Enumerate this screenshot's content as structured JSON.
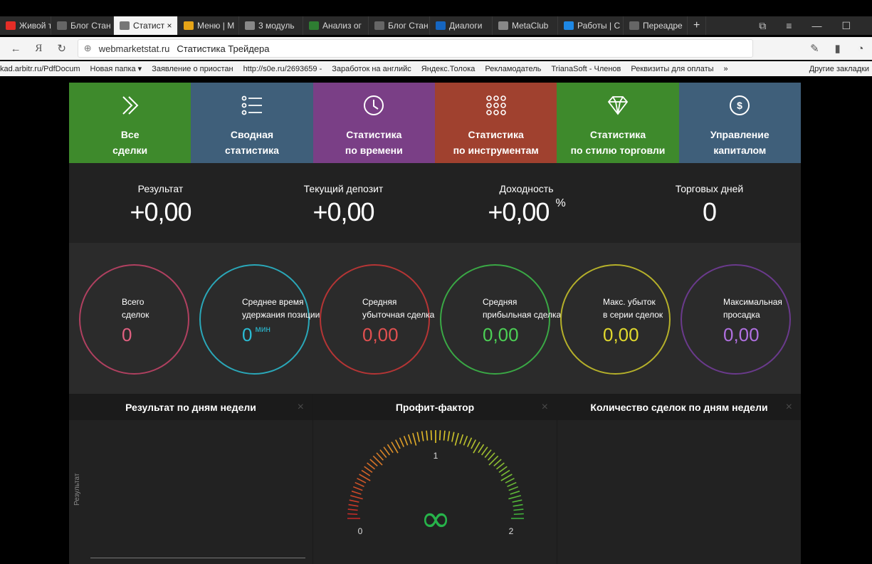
{
  "browser": {
    "tabs": [
      {
        "label": "Живой тр",
        "icon": "youtube-icon",
        "color": "#e52d27"
      },
      {
        "label": "Блог Стан",
        "icon": "page-icon",
        "color": "#666"
      },
      {
        "label": "Статист ×",
        "icon": "site-icon",
        "color": "#777",
        "active": true
      },
      {
        "label": "Меню | М",
        "icon": "st-icon",
        "color": "#e6a417"
      },
      {
        "label": "3 модуль",
        "icon": "gear-icon",
        "color": "#888"
      },
      {
        "label": "Анализ ог",
        "icon": "check-icon",
        "color": "#2e7d32"
      },
      {
        "label": "Блог Стан",
        "icon": "page-icon",
        "color": "#666"
      },
      {
        "label": "Диалоги",
        "icon": "chat-icon",
        "color": "#1565c0"
      },
      {
        "label": "MetaClub",
        "icon": "loading-icon",
        "color": "#888"
      },
      {
        "label": "Работы | С",
        "icon": "work-icon",
        "color": "#1e88e5"
      },
      {
        "label": "Переадре",
        "icon": "page-icon",
        "color": "#666"
      }
    ],
    "new_tab": "+",
    "domain": "webmarketstat.ru",
    "page_title": "Статистика Трейдера",
    "bookmarks": [
      "kad.arbitr.ru/PdfDocum",
      "Новая папка ▾",
      "Заявление о приостан",
      "http://s0e.ru/2693659 -",
      "Заработок на английс",
      "Яндекс.Толока",
      "Рекламодатель",
      "TrianaSoft - Членов",
      "Реквизиты для оплаты",
      "»"
    ],
    "other_bookmarks": "Другие закладки"
  },
  "nav_tiles": [
    {
      "line1": "Все",
      "line2": "сделки",
      "icon": "double-chevron-icon",
      "color": "#3e8a2c"
    },
    {
      "line1": "Сводная",
      "line2": "статистика",
      "icon": "list-icon",
      "color": "#3f5f7a"
    },
    {
      "line1": "Статистика",
      "line2": "по времени",
      "icon": "clock-icon",
      "color": "#7a3f86"
    },
    {
      "line1": "Статистика",
      "line2": "по инструментам",
      "icon": "grid-dots-icon",
      "color": "#a0412f"
    },
    {
      "line1": "Статистика",
      "line2": "по стилю торговли",
      "icon": "diamond-icon",
      "color": "#3e8a2c"
    },
    {
      "line1": "Управление",
      "line2": "капиталом",
      "icon": "dollar-coin-icon",
      "color": "#3f5f7a"
    }
  ],
  "stats": [
    {
      "label": "Результат",
      "value": "+0,00",
      "suffix": ""
    },
    {
      "label": "Текущий депозит",
      "value": "+0,00",
      "suffix": ""
    },
    {
      "label": "Доходность",
      "value": "+0,00",
      "suffix": "%"
    },
    {
      "label": "Торговых дней",
      "value": "0",
      "suffix": ""
    }
  ],
  "circles": [
    {
      "line1": "Всего",
      "line2": "сделок",
      "value": "0",
      "unit": "",
      "color": "#b04060",
      "value_color": "#e06080"
    },
    {
      "line1": "Среднее время",
      "line2": "удержания позиции",
      "value": "0",
      "unit": "мин",
      "color": "#2aa7b8",
      "value_color": "#2bbcd4"
    },
    {
      "line1": "Средняя",
      "line2": "убыточная сделка",
      "value": "0,00",
      "unit": "",
      "color": "#b53535",
      "value_color": "#e05050"
    },
    {
      "line1": "Средняя",
      "line2": "прибыльная сделка",
      "value": "0,00",
      "unit": "",
      "color": "#3aa845",
      "value_color": "#4ccf55"
    },
    {
      "line1": "Макс. убыток",
      "line2": "в серии сделок",
      "value": "0,00",
      "unit": "",
      "color": "#b5b02a",
      "value_color": "#e0d82e"
    },
    {
      "line1": "Максимальная",
      "line2": "просадка",
      "value": "0,00",
      "unit": "",
      "color": "#6a3a8c",
      "value_color": "#b070e0"
    }
  ],
  "panels": {
    "weekday_result": {
      "title": "Результат по дням недели",
      "ylabel": "Результат",
      "close": "×"
    },
    "profit_factor": {
      "title": "Профит-фактор",
      "close": "×",
      "value": "∞",
      "value_color": "#27b34a",
      "min_label": "0",
      "mid_label": "1",
      "max_label": "2",
      "scale": [
        0,
        2
      ]
    },
    "weekday_count": {
      "title": "Количество сделок по дням недели",
      "close": "×"
    }
  }
}
